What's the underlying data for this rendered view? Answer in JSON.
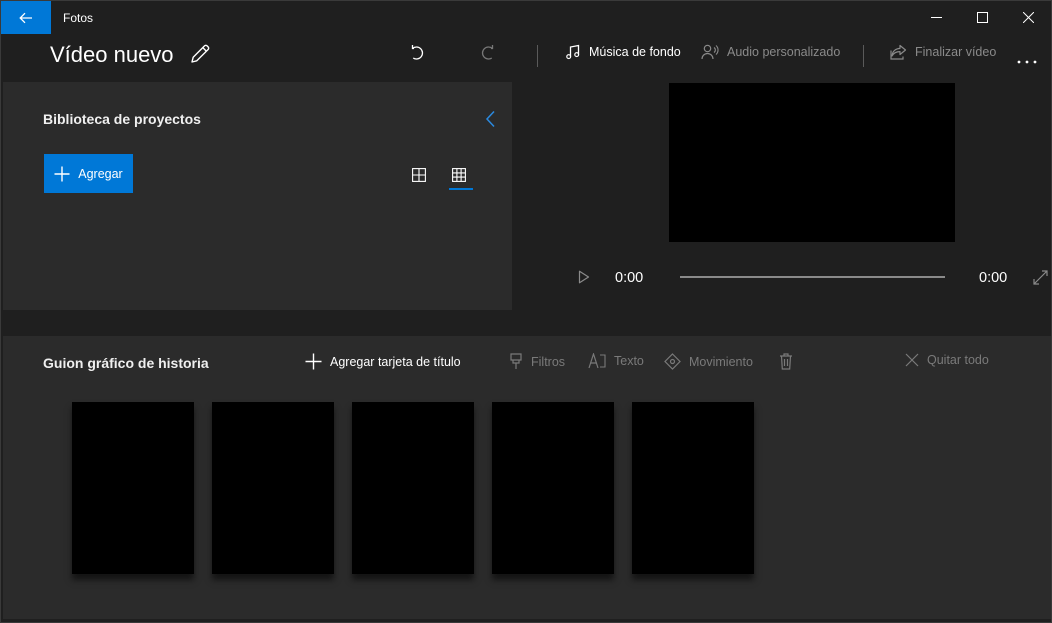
{
  "app": {
    "name": "Fotos"
  },
  "project": {
    "title": "Vídeo nuevo"
  },
  "commands": {
    "background_music": "Música de fondo",
    "custom_audio": "Audio personalizado",
    "finish_video": "Finalizar vídeo"
  },
  "library": {
    "title": "Biblioteca de proyectos",
    "add_label": "Agregar"
  },
  "player": {
    "current_time": "0:00",
    "total_time": "0:00",
    "progress": 0
  },
  "storyboard": {
    "title": "Guion gráfico de historia",
    "add_title_card": "Agregar tarjeta de título",
    "filters": "Filtros",
    "text": "Texto",
    "motion": "Movimiento",
    "remove_all": "Quitar todo",
    "clip_count": 5
  },
  "colors": {
    "accent": "#0078d7",
    "background": "#1f1f1f",
    "panel": "#2b2b2b",
    "disabled_text": "#8a8a8a"
  }
}
